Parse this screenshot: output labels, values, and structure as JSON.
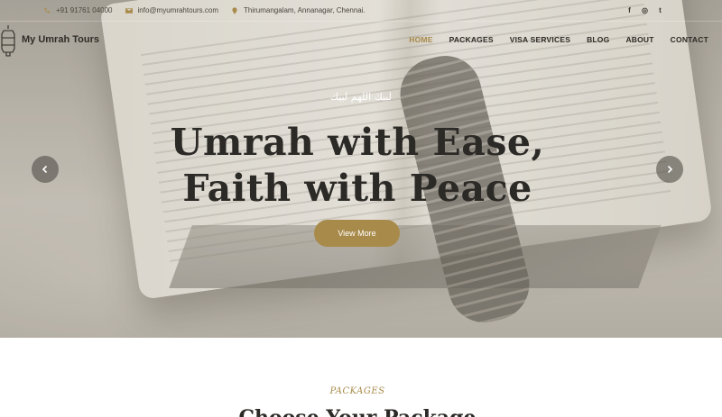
{
  "topbar": {
    "phone": "+91 91761 04000",
    "email": "info@myumrahtours.com",
    "address": "Thirumangalam, Annanagar, Chennai.",
    "social": [
      {
        "icon": "facebook-icon",
        "glyph": "f"
      },
      {
        "icon": "instagram-icon",
        "glyph": "◎"
      },
      {
        "icon": "twitter-icon",
        "glyph": "t"
      }
    ]
  },
  "brand": {
    "name": "My Umrah Tours"
  },
  "nav": {
    "items": [
      "HOME",
      "PACKAGES",
      "VISA SERVICES",
      "BLOG",
      "ABOUT",
      "CONTACT"
    ],
    "active": "HOME"
  },
  "hero": {
    "arabic": "لبيك اللهم لبيك",
    "headline_line1": "Umrah with Ease,",
    "headline_line2": "Faith with Peace",
    "cta": "View More"
  },
  "packages": {
    "label": "PACKAGES",
    "title": "Choose Your Package"
  },
  "colors": {
    "accent": "#a88a4a",
    "text_dark": "#2c2a26"
  }
}
